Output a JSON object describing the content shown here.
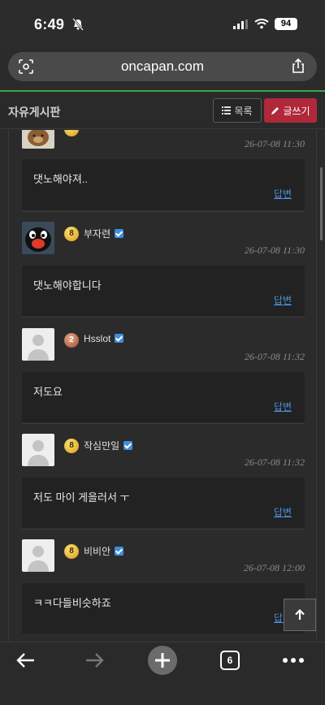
{
  "status_bar": {
    "time": "6:49",
    "battery": "94"
  },
  "browser": {
    "domain": "oncapan.com"
  },
  "board": {
    "title": "자유게시판",
    "list_label": "목록",
    "write_label": "글쓰기"
  },
  "comments": [
    {
      "avatar": "brown-bear-avatar",
      "rank": "",
      "nick": "",
      "verified": false,
      "date": "26-07-08 11:30",
      "text": "댓노해야져..",
      "reply_label": "답변"
    },
    {
      "avatar": "penguin-avatar",
      "rank": "8",
      "nick": "부자련",
      "verified": true,
      "date": "26-07-08 11:30",
      "text": "댓노해야합니다",
      "reply_label": "답변"
    },
    {
      "avatar": "default-avatar",
      "rank": "2",
      "nick": "Hsslot",
      "verified": true,
      "date": "26-07-08 11:32",
      "text": "저도요",
      "reply_label": "답변"
    },
    {
      "avatar": "default-avatar",
      "rank": "8",
      "nick": "작심만일",
      "verified": true,
      "date": "26-07-08 11:32",
      "text": "저도 마이 게을러서 ㅜ",
      "reply_label": "답변"
    },
    {
      "avatar": "default-avatar",
      "rank": "8",
      "nick": "비비안",
      "verified": true,
      "date": "26-07-08 12:00",
      "text": "ㅋㅋ다들비슷하죠",
      "reply_label": "답변"
    }
  ],
  "toolbar": {
    "tab_count": "6"
  },
  "colors": {
    "accent_green": "#3aa845",
    "write_button": "#b0283a",
    "link_blue": "#4a90d9"
  }
}
